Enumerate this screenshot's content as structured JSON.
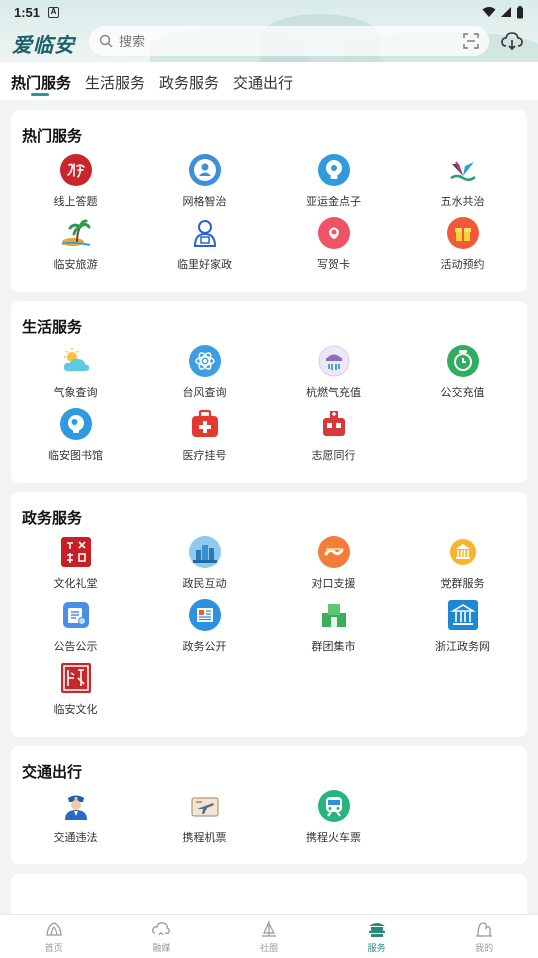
{
  "status": {
    "time": "1:51",
    "badge": "A"
  },
  "app": {
    "logo": "爱临安"
  },
  "search": {
    "placeholder": "搜索"
  },
  "tabs": [
    {
      "label": "热门服务",
      "active": true
    },
    {
      "label": "生活服务",
      "active": false
    },
    {
      "label": "政务服务",
      "active": false
    },
    {
      "label": "交通出行",
      "active": false
    }
  ],
  "sections": [
    {
      "title": "热门服务",
      "items": [
        {
          "label": "线上答题",
          "icon": "hangzhou-seal-icon"
        },
        {
          "label": "网格智治",
          "icon": "person-circle-icon"
        },
        {
          "label": "亚运金点子",
          "icon": "bulb-icon"
        },
        {
          "label": "五水共治",
          "icon": "water-icon"
        },
        {
          "label": "临安旅游",
          "icon": "palm-island-icon"
        },
        {
          "label": "临里好家政",
          "icon": "housekeeper-icon"
        },
        {
          "label": "写贺卡",
          "icon": "card-icon"
        },
        {
          "label": "活动预约",
          "icon": "gift-icon"
        }
      ]
    },
    {
      "title": "生活服务",
      "items": [
        {
          "label": "气象查询",
          "icon": "weather-icon"
        },
        {
          "label": "台风查询",
          "icon": "typhoon-icon"
        },
        {
          "label": "杭燃气充值",
          "icon": "gas-icon"
        },
        {
          "label": "公交充值",
          "icon": "bus-card-icon"
        },
        {
          "label": "临安图书馆",
          "icon": "library-icon"
        },
        {
          "label": "医疗挂号",
          "icon": "medical-icon"
        },
        {
          "label": "志愿同行",
          "icon": "volunteer-icon"
        }
      ]
    },
    {
      "title": "政务服务",
      "items": [
        {
          "label": "文化礼堂",
          "icon": "culture-seal-icon"
        },
        {
          "label": "政民互动",
          "icon": "city-icon"
        },
        {
          "label": "对口支援",
          "icon": "support-icon"
        },
        {
          "label": "党群服务",
          "icon": "party-icon"
        },
        {
          "label": "公告公示",
          "icon": "notice-icon"
        },
        {
          "label": "政务公开",
          "icon": "news-icon"
        },
        {
          "label": "群团集市",
          "icon": "market-icon"
        },
        {
          "label": "浙江政务网",
          "icon": "gov-building-icon"
        },
        {
          "label": "临安文化",
          "icon": "linan-seal-icon"
        }
      ]
    },
    {
      "title": "交通出行",
      "items": [
        {
          "label": "交通违法",
          "icon": "police-icon"
        },
        {
          "label": "携程机票",
          "icon": "plane-ticket-icon"
        },
        {
          "label": "携程火车票",
          "icon": "train-icon"
        }
      ]
    }
  ],
  "bottom_nav": [
    {
      "label": "首页",
      "icon": "home-icon",
      "active": false
    },
    {
      "label": "融媒",
      "icon": "media-icon",
      "active": false
    },
    {
      "label": "社圈",
      "icon": "community-icon",
      "active": false
    },
    {
      "label": "服务",
      "icon": "service-icon",
      "active": true
    },
    {
      "label": "我的",
      "icon": "profile-icon",
      "active": false
    }
  ],
  "colors": {
    "accent": "#2b9a8c",
    "header": "#d8ebe9",
    "background": "#f2f3f5"
  }
}
